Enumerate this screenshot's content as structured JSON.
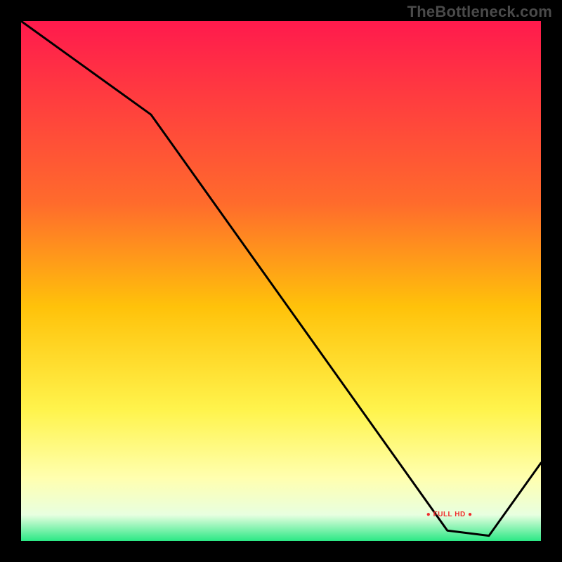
{
  "watermark": "TheBottleneck.com",
  "annotation": {
    "text": "● FULL HD ●"
  },
  "chart_data": {
    "type": "line",
    "title": "",
    "xlabel": "",
    "ylabel": "",
    "xlim": [
      0,
      100
    ],
    "ylim": [
      0,
      100
    ],
    "x": [
      0,
      25,
      82,
      90,
      100
    ],
    "values": [
      100,
      82,
      2,
      1,
      15
    ],
    "gradient_stops": [
      {
        "pct": 0,
        "color": "#ff1a4d"
      },
      {
        "pct": 35,
        "color": "#ff6b2c"
      },
      {
        "pct": 55,
        "color": "#ffc20a"
      },
      {
        "pct": 75,
        "color": "#fff44d"
      },
      {
        "pct": 88,
        "color": "#ffffb0"
      },
      {
        "pct": 95,
        "color": "#e8ffe0"
      },
      {
        "pct": 100,
        "color": "#2be885"
      }
    ],
    "annotation_xy": [
      82,
      5
    ]
  }
}
